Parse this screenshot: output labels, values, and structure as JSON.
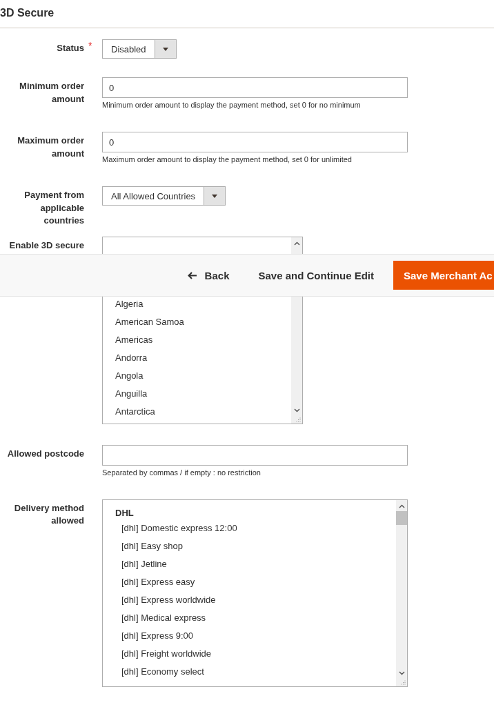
{
  "section": {
    "title": "3D Secure"
  },
  "fields": [
    {
      "kind": "select",
      "label": "Status",
      "required_mark": "*",
      "value": "Disabled"
    },
    {
      "kind": "text",
      "label": "Minimum order amount",
      "value": "0",
      "note": "Minimum order amount to display the payment method, set 0 for no minimum"
    },
    {
      "kind": "text",
      "label": "Maximum order amount",
      "value": "0",
      "note": "Maximum order amount to display the payment method, set 0 for unlimited"
    },
    {
      "kind": "select",
      "label": "Payment from applicable countries",
      "value": "All Allowed Countries"
    },
    {
      "kind": "multiselect",
      "label": "Enable 3D secure",
      "options": [
        "Algeria",
        "American Samoa",
        "Americas",
        "Andorra",
        "Angola",
        "Anguilla",
        "Antarctica"
      ]
    },
    {
      "kind": "text",
      "label": "Allowed postcode",
      "note": "Separated by commas / if empty : no restriction"
    },
    {
      "kind": "grouped",
      "label": "Delivery method allowed",
      "group": "DHL",
      "options": [
        "[dhl] Domestic express 12:00",
        "[dhl] Easy shop",
        "[dhl] Jetline",
        "[dhl] Express easy",
        "[dhl] Express worldwide",
        "[dhl] Medical express",
        "[dhl] Express 9:00",
        "[dhl] Freight worldwide",
        "[dhl] Economy select"
      ]
    }
  ],
  "action_bar": {
    "back": "Back",
    "save_continue": "Save and Continue Edit",
    "save": "Save Merchant Ac"
  }
}
